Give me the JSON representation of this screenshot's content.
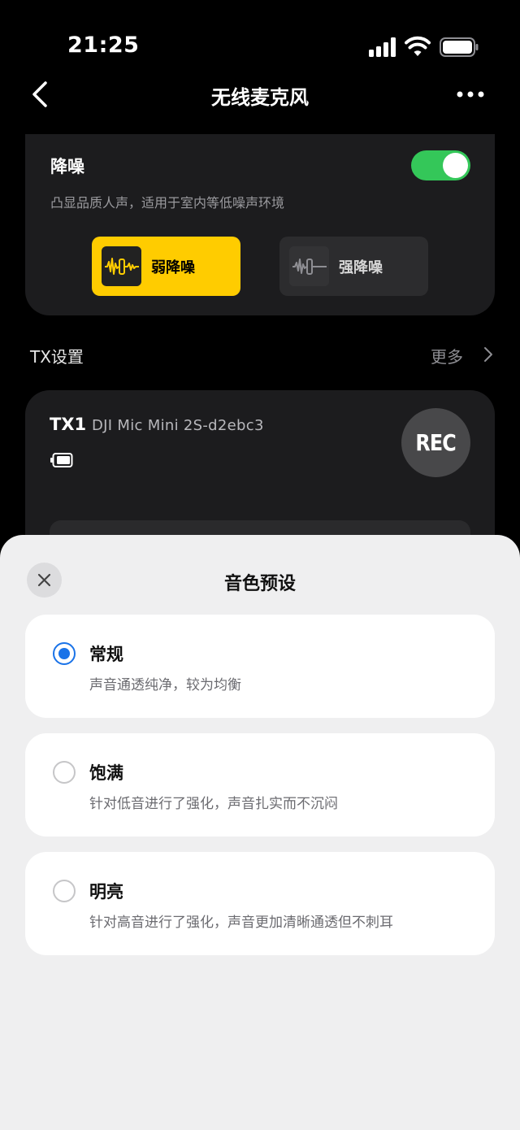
{
  "status_bar": {
    "time": "21:25"
  },
  "nav": {
    "title": "无线麦克风"
  },
  "noise_reduction": {
    "title": "降噪",
    "description": "凸显品质人声，适用于室内等低噪声环境",
    "enabled": true,
    "options": [
      {
        "label": "弱降噪",
        "selected": true
      },
      {
        "label": "强降噪",
        "selected": false
      }
    ],
    "accent_color": "#ffcc00",
    "toggle_color": "#34c759"
  },
  "tx_settings": {
    "label": "TX设置",
    "more_label": "更多",
    "device_id": "TX1",
    "device_name": "DJI Mic Mini 2S-d2ebc3",
    "rec_label": "REC"
  },
  "sheet": {
    "title": "音色预设",
    "options": [
      {
        "title": "常规",
        "description": "声音通透纯净，较为均衡",
        "selected": true
      },
      {
        "title": "饱满",
        "description": "针对低音进行了强化，声音扎实而不沉闷",
        "selected": false
      },
      {
        "title": "明亮",
        "description": "针对高音进行了强化，声音更加清晰通透但不刺耳",
        "selected": false
      }
    ],
    "selected_color": "#1a73e8"
  }
}
